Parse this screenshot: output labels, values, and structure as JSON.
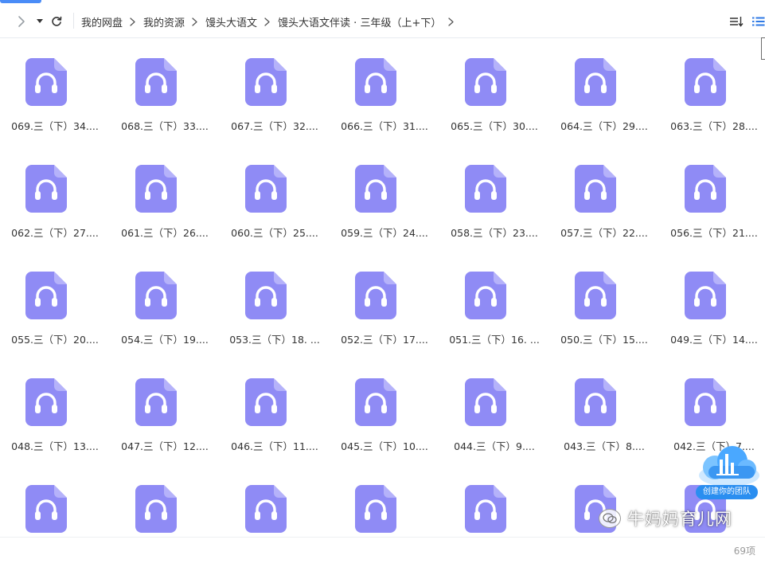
{
  "toolbar": {
    "breadcrumb": [
      "我的网盘",
      "我的资源",
      "馒头大语文",
      "馒头大语文伴读 · 三年级（上+下）"
    ]
  },
  "files": [
    "069.三（下）34....",
    "068.三（下）33....",
    "067.三（下）32....",
    "066.三（下）31....",
    "065.三（下）30....",
    "064.三（下）29....",
    "063.三（下）28....",
    "062.三（下）27....",
    "061.三（下）26....",
    "060.三（下）25....",
    "059.三（下）24....",
    "058.三（下）23....",
    "057.三（下）22....",
    "056.三（下）21....",
    "055.三（下）20....",
    "054.三（下）19....",
    "053.三（下）18. ...",
    "052.三（下）17....",
    "051.三（下）16. ...",
    "050.三（下）15....",
    "049.三（下）14....",
    "048.三（下）13....",
    "047.三（下）12....",
    "046.三（下）11....",
    "045.三（下）10....",
    "044.三（下）9....",
    "043.三（下）8....",
    "042.三（下）7....",
    "",
    "",
    "",
    "",
    "",
    "",
    ""
  ],
  "icons": {
    "file_type": "audio-file-icon",
    "file_color": "#8f8bf5",
    "file_fold_color": "#b5b2fa"
  },
  "status": {
    "count": "69项"
  },
  "promo": {
    "label": "创建你的团队"
  },
  "watermark": {
    "text": "牛妈妈育儿网"
  }
}
